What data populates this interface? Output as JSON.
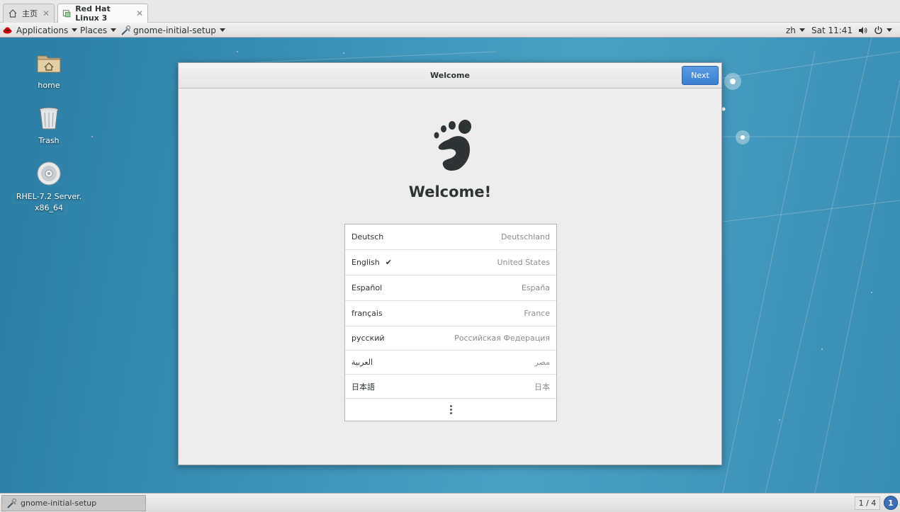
{
  "vm_tabs": [
    {
      "label": "主页",
      "icon": "home-icon"
    },
    {
      "label": "Red Hat Linux 3",
      "icon": "vm-icon"
    }
  ],
  "top_panel": {
    "applications": "Applications",
    "places": "Places",
    "app_menu": "gnome-initial-setup",
    "input_method": "zh",
    "clock": "Sat 11:41"
  },
  "desktop_icons": [
    {
      "label": "home",
      "icon": "folder-home-icon"
    },
    {
      "label": "Trash",
      "icon": "trash-icon"
    },
    {
      "label": "RHEL-7.2 Server. x86_64",
      "icon": "disc-icon"
    }
  ],
  "dialog": {
    "title": "Welcome",
    "next_label": "Next",
    "heading": "Welcome!",
    "languages": [
      {
        "name": "Deutsch",
        "region": "Deutschland",
        "selected": false
      },
      {
        "name": "English",
        "region": "United States",
        "selected": true,
        "check": "✔"
      },
      {
        "name": "Español",
        "region": "España",
        "selected": false
      },
      {
        "name": "français",
        "region": "France",
        "selected": false
      },
      {
        "name": "русский",
        "region": "Российская Федерация",
        "selected": false
      },
      {
        "name": "العربية",
        "region": "مصر",
        "selected": false
      },
      {
        "name": "日本語",
        "region": "日本",
        "selected": false
      }
    ]
  },
  "bottom_panel": {
    "task_label": "gnome-initial-setup",
    "workspace": "1 / 4",
    "notification": "1"
  },
  "colors": {
    "desktop_bg": "#3b8fb3",
    "accent": "#3a7fd2"
  }
}
